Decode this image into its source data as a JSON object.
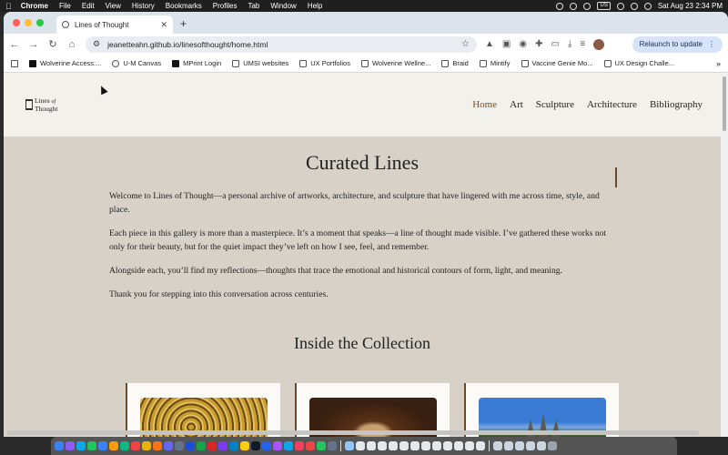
{
  "menubar": {
    "app": "Chrome",
    "items": [
      "File",
      "Edit",
      "View",
      "History",
      "Bookmarks",
      "Profiles",
      "Tab",
      "Window",
      "Help"
    ],
    "input_source": "US",
    "clock": "Sat Aug 23  2:34 PM"
  },
  "browser": {
    "tab_title": "Lines of Thought",
    "url": "jeanetteahn.github.io/linesofthought/home.html",
    "relaunch_label": "Relaunch to update",
    "bookmarks": [
      "Wolverine Access:...",
      "U-M Canvas",
      "MPrint Login",
      "UMSI websites",
      "UX Portfolios",
      "Wolverine Wellne...",
      "Braid",
      "Mintify",
      "Vaccine Genie Mo...",
      "UX Design Challe..."
    ]
  },
  "site": {
    "logo_line1": "Lines",
    "logo_of": "of",
    "logo_line2": "Thought",
    "nav": [
      "Home",
      "Art",
      "Sculpture",
      "Architecture",
      "Bibliography"
    ],
    "title": "Curated Lines",
    "paragraphs": [
      "Welcome to Lines of Thought—a personal archive of artworks, architecture, and sculpture that have lingered with me across time, style, and place.",
      "Each piece in this gallery is more than a masterpiece. It’s a moment that speaks—a line of thought made visible. I’ve gathered these works not only for their beauty, but for the quiet impact they’ve left on how I see, feel, and remember.",
      "Alongside each, you’ll find my reflections—thoughts that trace the emotional and historical contours of form, light, and meaning.",
      "Thank you for stepping into this conversation across centuries."
    ],
    "section_title": "Inside the Collection"
  },
  "colors": {
    "page_bg": "#d7d1c7",
    "header_bg": "#f3f1ec",
    "accent_brown": "#6b4a2c",
    "active_nav": "#7a4b20"
  }
}
